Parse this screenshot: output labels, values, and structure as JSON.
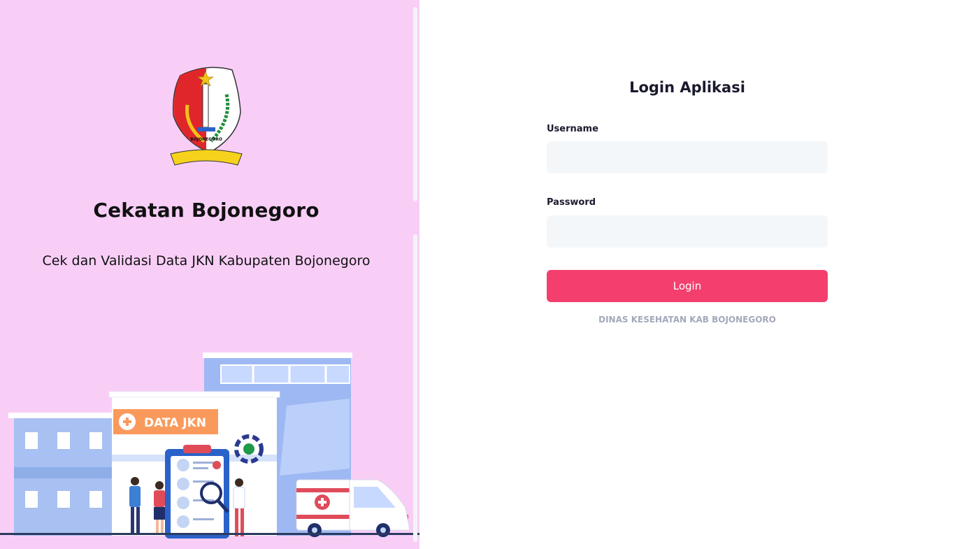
{
  "left": {
    "logo_label": "BOJONEGORO",
    "title": "Cekatan Bojonegoro",
    "subtitle": "Cek dan Validasi Data JKN Kabupaten Bojonegoro",
    "illustration_sign": "DATA JKN"
  },
  "login": {
    "title": "Login Aplikasi",
    "username_label": "Username",
    "username_value": "",
    "password_label": "Password",
    "password_value": "",
    "button_label": "Login",
    "footer": "DINAS KESEHATAN KAB BOJONEGORO"
  },
  "colors": {
    "left_bg": "#f8cef7",
    "accent": "#f43f6e",
    "input_bg": "#f4f7fa",
    "footer_text": "#a3a8ba"
  },
  "icons": {
    "logo": "bojonegoro-crest-icon",
    "sign_plus": "plus-circle-icon",
    "ambulance_cross": "medical-cross-icon"
  }
}
